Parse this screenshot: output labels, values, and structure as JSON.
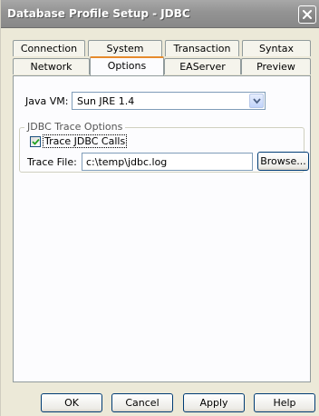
{
  "window": {
    "title": "Database Profile Setup - JDBC"
  },
  "tabs": {
    "top_row": [
      "Connection",
      "System",
      "Transaction",
      "Syntax"
    ],
    "bottom_row": [
      "Network",
      "Options",
      "EAServer",
      "Preview"
    ],
    "active": "Options"
  },
  "options": {
    "java_vm_label": "Java VM:",
    "java_vm_value": "Sun JRE 1.4",
    "trace_group_title": "JDBC Trace Options",
    "trace_checkbox_label": "Trace JDBC Calls",
    "trace_checked": true,
    "trace_file_label": "Trace File:",
    "trace_file_value": "c:\\temp\\jdbc.log",
    "browse_label": "Browse..."
  },
  "buttons": {
    "ok": "OK",
    "cancel": "Cancel",
    "apply": "Apply",
    "help": "Help"
  },
  "colors": {
    "titlebar": "#939393",
    "active_tab_accent": "#e68b2c",
    "button_border": "#003c74",
    "field_border": "#7f9db9"
  }
}
